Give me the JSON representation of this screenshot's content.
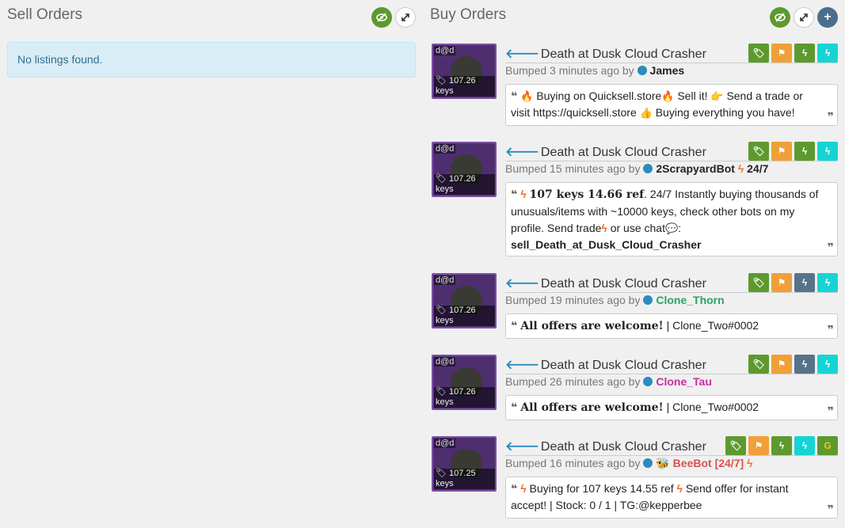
{
  "sell": {
    "title": "Sell Orders",
    "empty_text": "No listings found.",
    "icons": [
      "eye-slash-icon",
      "expand-icon"
    ]
  },
  "buy": {
    "title": "Buy Orders",
    "icons": [
      "eye-slash-icon",
      "expand-icon",
      "plus-icon"
    ],
    "listings": [
      {
        "item_name": "Death at Dusk Cloud Crasher",
        "item_tag": "d@d",
        "price": "107.26 keys",
        "bumped_prefix": "Bumped 3 minutes ago by",
        "user": "James",
        "user_suffix": "",
        "quote_parts": [
          "🔥",
          "Buying on Quicksell.store",
          "🔥",
          "Sell it!",
          "👉",
          "Send a trade or visit https://quicksell.store",
          "👍",
          "Buying everything you have!"
        ],
        "badges": [
          "tag",
          "flag",
          "bolt-green",
          "bolt-cyan"
        ]
      },
      {
        "item_name": "Death at Dusk Cloud Crasher",
        "item_tag": "d@d",
        "price": "107.26 keys",
        "bumped_prefix": "Bumped 15 minutes ago by",
        "user": "2ScrapyardBot",
        "user_suffix": "24/7",
        "quote_parts": [
          "107 keys 14.66 ref",
          ". 24/7 Instantly buying thousands of unusuals/items with ~10000 keys, check other bots on my profile. Send  trade",
          "or  use  chat",
          ":",
          "sell_Death_at_Dusk_Cloud_Crasher"
        ],
        "badges": [
          "tag",
          "flag",
          "bolt-green",
          "bolt-cyan"
        ]
      },
      {
        "item_name": "Death at Dusk Cloud Crasher",
        "item_tag": "d@d",
        "price": "107.26 keys",
        "bumped_prefix": "Bumped 19 minutes ago by",
        "user": "Clone_Thorn",
        "user_suffix": "",
        "quote_parts": [
          "All offers are welcome!",
          " | Clone_Two#0002"
        ],
        "badges": [
          "tag",
          "flag",
          "bolt-slate",
          "bolt-cyan"
        ]
      },
      {
        "item_name": "Death at Dusk Cloud Crasher",
        "item_tag": "d@d",
        "price": "107.26 keys",
        "bumped_prefix": "Bumped 26 minutes ago by",
        "user": "Clone_Tau",
        "user_suffix": "",
        "quote_parts": [
          "All offers are welcome!",
          " | Clone_Two#0002"
        ],
        "badges": [
          "tag",
          "flag",
          "bolt-slate",
          "bolt-cyan"
        ]
      },
      {
        "item_name": "Death at Dusk Cloud Crasher",
        "item_tag": "d@d",
        "price": "107.25 keys",
        "bumped_prefix": "Bumped 16 minutes ago by",
        "user": "BeeBot [24/7]",
        "user_suffix": "",
        "quote_parts": [
          "Buying for 107 keys 14.55 ref",
          "Send offer for instant accept! | Stock: 0 / 1 | TG:@kepperbee"
        ],
        "badges": [
          "tag",
          "flag",
          "bolt-green",
          "bolt-cyan",
          "g-coin"
        ]
      }
    ]
  },
  "colors": {
    "green": "#5d9a2e",
    "orange": "#f0a038",
    "cyan": "#17d4d4",
    "slate": "#56738a",
    "link_blue": "#2b8bbf",
    "unusual_purple": "#7d4fa8"
  }
}
